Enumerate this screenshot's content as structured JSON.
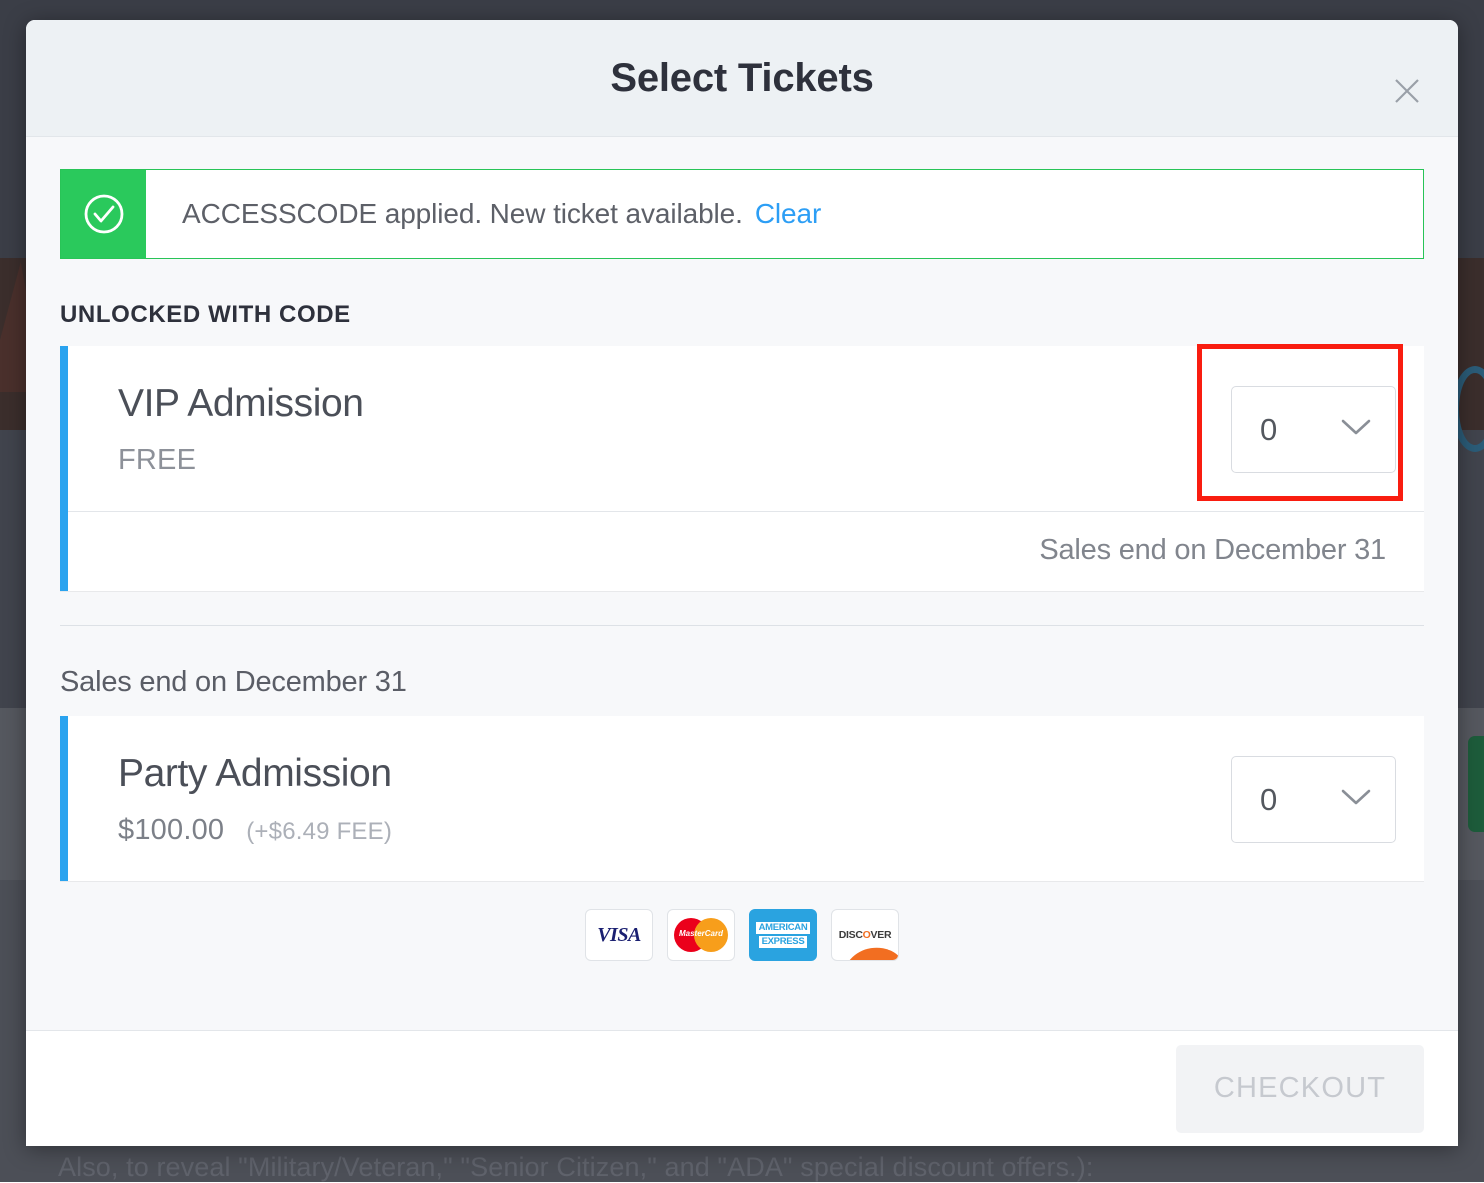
{
  "background": {
    "text_line": "Also, to reveal \"Military/Veteran,\" \"Senior Citizen,\" and \"ADA\" special discount offers.):"
  },
  "modal": {
    "title": "Select Tickets",
    "close_icon": "close-icon",
    "alert": {
      "icon": "check-circle-icon",
      "message": "ACCESSCODE applied. New ticket available.",
      "action_label": "Clear",
      "accent_color": "#2ac95c",
      "link_color": "#2c9ef5"
    },
    "sections": [
      {
        "label": "UNLOCKED WITH CODE",
        "tickets": [
          {
            "name": "VIP Admission",
            "price": "FREE",
            "fee": "",
            "quantity": "0",
            "chevron_icon": "chevron-down-icon",
            "footer_note": "Sales end on December 31",
            "accent_color": "#2aa3ef",
            "highlighted": true
          }
        ]
      },
      {
        "label": "Sales end on December 31",
        "tickets": [
          {
            "name": "Party Admission",
            "price": "$100.00",
            "fee": "(+$6.49 FEE)",
            "quantity": "0",
            "chevron_icon": "chevron-down-icon",
            "footer_note": "",
            "accent_color": "#2aa3ef",
            "highlighted": false
          }
        ]
      }
    ],
    "payment_methods": [
      {
        "name": "visa",
        "label": "VISA"
      },
      {
        "name": "mastercard",
        "label": "MasterCard"
      },
      {
        "name": "american-express",
        "label_line1": "AMERICAN",
        "label_line2": "EXPRESS"
      },
      {
        "name": "discover",
        "label_a": "DISC",
        "label_o": "O",
        "label_b": "VER"
      }
    ],
    "footer": {
      "checkout_label": "CHECKOUT",
      "checkout_disabled": true
    }
  }
}
